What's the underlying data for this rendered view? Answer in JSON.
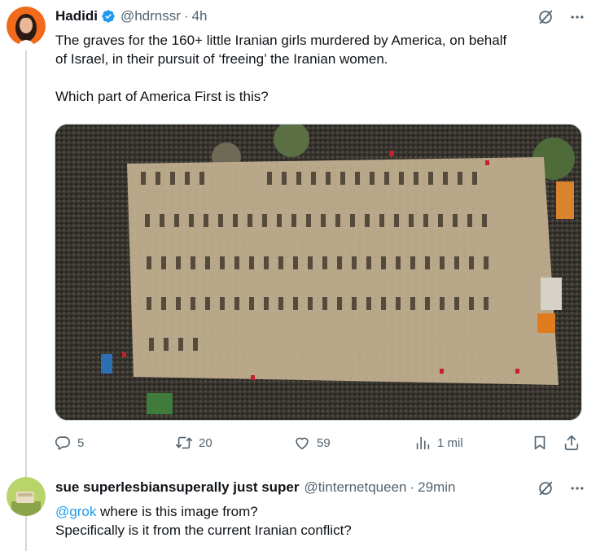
{
  "tweet": {
    "author_name": "Hadidi",
    "handle": "@hdrnssr",
    "time": "4h",
    "text_line1": "The graves for the 160+ little Iranian girls murdered by America, on behalf",
    "text_line2": "of Israel, in their pursuit of ‘freeing’ the Iranian women.",
    "text_line3": "Which part of America First is this?",
    "stats": {
      "replies": "5",
      "reposts": "20",
      "likes": "59",
      "views": "1 mil"
    }
  },
  "reply": {
    "author_name": "sue superlesbiansuperally just super",
    "handle": "@tinternetqueen",
    "time": "29min",
    "mention": "@grok",
    "text_line1_rest": " where is this image from?",
    "text_line2": "Specifically is it from the current Iranian conflict?"
  },
  "colors": {
    "accent": "#1d9bf0",
    "muted": "#536471",
    "text": "#0f1419",
    "avatar_bg": "#f26a1b"
  },
  "icons": {
    "verified": "verified-badge-icon",
    "grok": "grok-icon",
    "more": "more-icon",
    "reply": "reply-icon",
    "repost": "repost-icon",
    "like": "like-icon",
    "views": "views-icon",
    "bookmark": "bookmark-icon",
    "share": "share-icon"
  }
}
